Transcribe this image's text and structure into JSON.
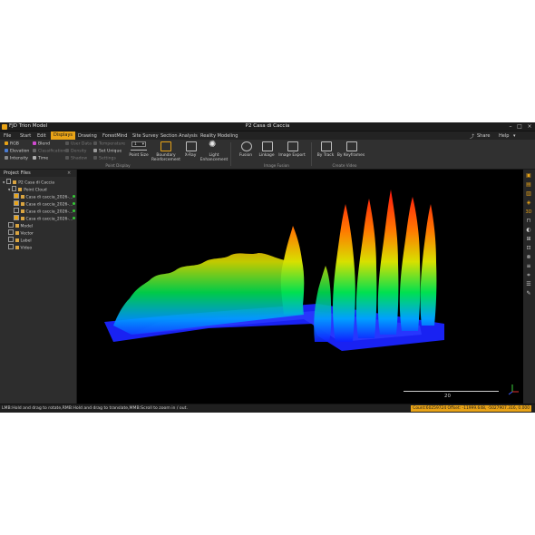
{
  "window": {
    "app_name": "FJD Trion Model",
    "document_title": "P2 Casa di Caccia"
  },
  "menu": {
    "items": [
      "File",
      "Start",
      "Edit",
      "Displays",
      "Drawing",
      "ForestMind",
      "Site Survey",
      "Section Analysis",
      "Reality Modeling"
    ],
    "active": "Displays",
    "share": "Share",
    "help": "Help"
  },
  "ribbon": {
    "col1": [
      "RGB",
      "Elevation",
      "Intensity"
    ],
    "col2": [
      "Blend",
      "Classification",
      "Time"
    ],
    "col3": [
      "User Data",
      "Density",
      "Shadow"
    ],
    "col4": [
      "Temperature",
      "Set Unique",
      "Settings"
    ],
    "point_size_value": "1",
    "point_size": "Point Size",
    "boundary": "Boundary Reinforcement",
    "xray": "X-Ray",
    "light": "Light Enhancement",
    "fusion": "Fusion",
    "linkage": "Linkage",
    "image_export": "Image Export",
    "by_track": "By Track",
    "by_keyframes": "By Keyframes",
    "group_point_display": "Point Display",
    "group_image_fusion": "Image Fusion",
    "group_create_video": "Create Video"
  },
  "project_files": {
    "header": "Project Files",
    "root": "P2 Casa di Caccia",
    "point_cloud": "Point Cloud",
    "clouds": [
      "Casa di caccia_2026-...",
      "Casa di caccia_2026-...",
      "Casa di caccia_2026-...",
      "Casa di caccia_2026-..."
    ],
    "model": "Model",
    "vector": "Vector",
    "label": "Label",
    "video": "Video"
  },
  "viewport": {
    "scale_label": "20"
  },
  "status": {
    "hint": "LMB:Hold and drag to rotate,RMB:Hold and drag to translate,MMB:Scroll to zoom in / out.",
    "coords": "Count:60259724  Offset: -11999.648, -5027907.316, 0.000"
  },
  "colors": {
    "accent": "#e8a317",
    "viewport_bg": "#000000"
  }
}
